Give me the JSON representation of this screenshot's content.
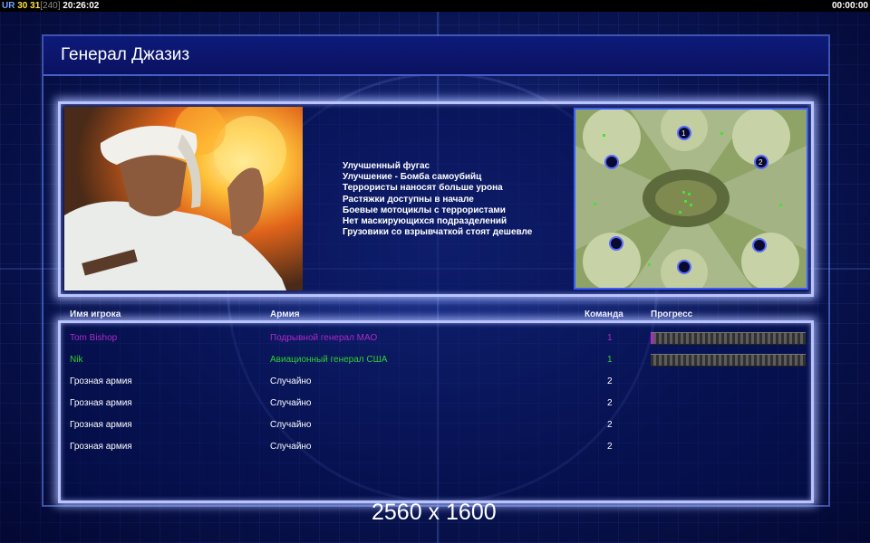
{
  "status_bar": {
    "ur": "UR",
    "value1": "30",
    "value2": "31",
    "value3": "[240]",
    "clock": "20:26:02",
    "timer": "00:00:00"
  },
  "title": "Генерал Джазиз",
  "description": [
    "Улучшенный фугас",
    "Улучшение - Бомба самоубийц",
    "Террористы наносят больше урона",
    "Растяжки доступны в начале",
    "Боевые мотоциклы с террористами",
    "Нет маскирующихся подразделений",
    "Грузовики со взрывчаткой стоят дешевле"
  ],
  "map": {
    "start_positions": [
      "1",
      "2"
    ]
  },
  "table": {
    "headers": {
      "player": "Имя игрока",
      "army": "Армия",
      "team": "Команда",
      "progress": "Прогресс"
    },
    "rows": [
      {
        "player": "Tom Bishop",
        "army": "Подрывной генерал МАО",
        "team": "1",
        "color": "#b028c8",
        "progress": 0.02
      },
      {
        "player": "Nik",
        "army": "Авиационный генерал США",
        "team": "1",
        "color": "#2fd02f",
        "progress": 0
      },
      {
        "player": "Грозная армия",
        "army": "Случайно",
        "team": "2",
        "color": "#ffffff"
      },
      {
        "player": "Грозная армия",
        "army": "Случайно",
        "team": "2",
        "color": "#ffffff"
      },
      {
        "player": "Грозная армия",
        "army": "Случайно",
        "team": "2",
        "color": "#ffffff"
      },
      {
        "player": "Грозная армия",
        "army": "Случайно",
        "team": "2",
        "color": "#ffffff"
      }
    ]
  },
  "resolution": "2560 x 1600"
}
